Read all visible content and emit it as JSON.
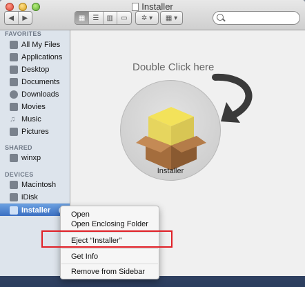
{
  "window": {
    "title": "Installer"
  },
  "toolbar": {
    "back_icon": "back-arrow",
    "forward_icon": "forward-arrow",
    "view_icons": [
      "icon-view",
      "list-view",
      "column-view",
      "coverflow-view"
    ],
    "action_icon": "gear",
    "arrange_icon": "arrange-grid",
    "search_placeholder": ""
  },
  "sidebar": {
    "favorites_header": "FAVORITES",
    "favorites": [
      {
        "label": "All My Files",
        "icon": "all-files"
      },
      {
        "label": "Applications",
        "icon": "applications"
      },
      {
        "label": "Desktop",
        "icon": "desktop"
      },
      {
        "label": "Documents",
        "icon": "documents"
      },
      {
        "label": "Downloads",
        "icon": "downloads"
      },
      {
        "label": "Movies",
        "icon": "movies"
      },
      {
        "label": "Music",
        "icon": "music"
      },
      {
        "label": "Pictures",
        "icon": "pictures"
      }
    ],
    "shared_header": "SHARED",
    "shared": [
      {
        "label": "winxp",
        "icon": "network-computer"
      }
    ],
    "devices_header": "DEVICES",
    "devices": [
      {
        "label": "Macintosh",
        "icon": "hard-drive"
      },
      {
        "label": "iDisk",
        "icon": "idisk"
      },
      {
        "label": "Installer",
        "icon": "disk-image"
      }
    ]
  },
  "content": {
    "hint_text": "Double Click here",
    "package_label": "Installer"
  },
  "context_menu": {
    "items": [
      "Open",
      "Open Enclosing Folder",
      "Eject “Installer”",
      "Get Info",
      "Remove from Sidebar"
    ]
  },
  "colors": {
    "highlight": "#e01f26",
    "selection": "#3b6fc2"
  }
}
